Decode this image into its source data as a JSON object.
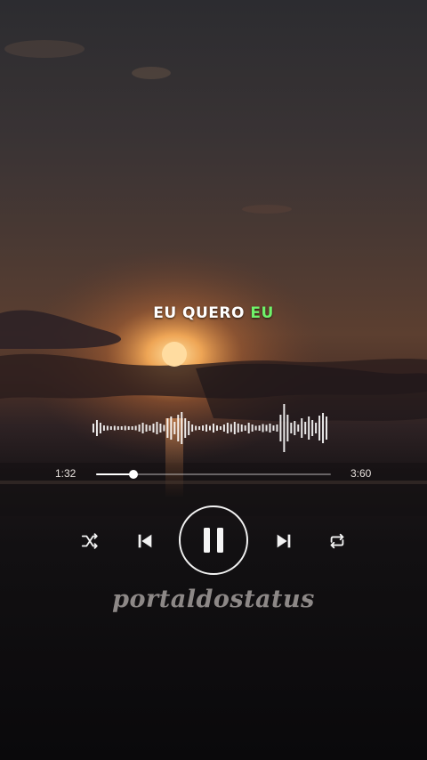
{
  "lyric": {
    "text": "EU QUERO",
    "highlight": "EU"
  },
  "player": {
    "current_time": "1:32",
    "total_time": "3:60",
    "progress": 0.16,
    "state": "playing",
    "controls": [
      "shuffle-icon",
      "previous-icon",
      "pause-icon",
      "next-icon",
      "repeat-icon"
    ]
  },
  "watermark": "portaldostatus",
  "colors": {
    "highlight": "#6ff26a",
    "foreground": "#ffffff",
    "sun": "#ffc870",
    "sky_top": "#2e2d31",
    "horizon": "#5a3a2c"
  }
}
